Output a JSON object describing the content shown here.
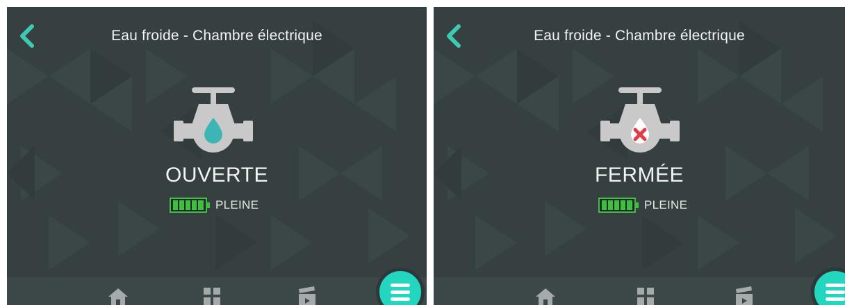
{
  "colors": {
    "background": "#364040",
    "accent": "#3ec9b3",
    "open_drop": "#3db5b5",
    "closed_x": "#e23c44",
    "battery_green": "#3fbf3f",
    "fab": "#22d6c0"
  },
  "screens": [
    {
      "title": "Eau froide - Chambre électrique",
      "status": "OUVERTE",
      "status_icon": "water-drop-icon",
      "battery_label": "PLEINE",
      "battery_level": 1.0
    },
    {
      "title": "Eau froide - Chambre électrique",
      "status": "FERMÉE",
      "status_icon": "red-x-icon",
      "battery_label": "PLEINE",
      "battery_level": 1.0
    }
  ],
  "nav": {
    "icons": [
      "home-icon",
      "grid-icon",
      "scenes-clapperboard-icon"
    ],
    "menu_icon": "hamburger-menu-icon"
  }
}
